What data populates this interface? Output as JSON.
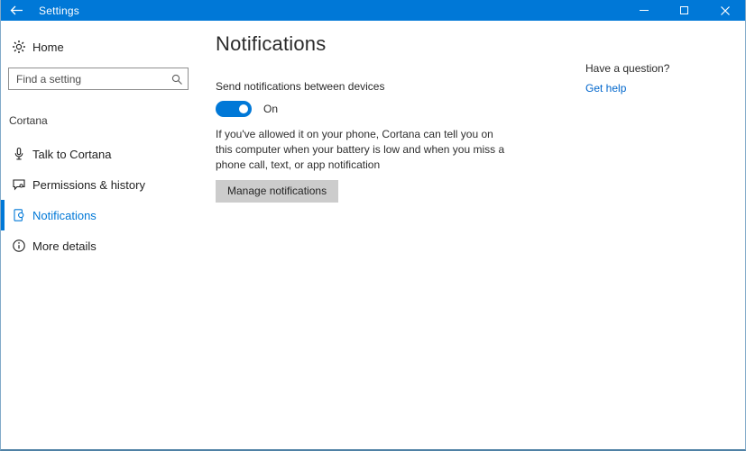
{
  "window": {
    "title": "Settings"
  },
  "sidebar": {
    "home_label": "Home",
    "search_placeholder": "Find a setting",
    "section_label": "Cortana",
    "items": [
      {
        "label": "Talk to Cortana",
        "icon": "microphone-icon"
      },
      {
        "label": "Permissions & history",
        "icon": "permissions-icon"
      },
      {
        "label": "Notifications",
        "icon": "notifications-icon"
      },
      {
        "label": "More details",
        "icon": "info-icon"
      }
    ]
  },
  "main": {
    "title": "Notifications",
    "setting_label": "Send notifications between devices",
    "toggle_state_label": "On",
    "description": "If you've allowed it on your phone, Cortana can tell you on this computer when your battery is low and when you miss a phone call, text, or app notification",
    "manage_button_label": "Manage notifications"
  },
  "help": {
    "question": "Have a question?",
    "link_label": "Get help"
  },
  "colors": {
    "accent": "#0078d7",
    "titlebar_background": "#0078d7",
    "selected_item_text": "#0078d7",
    "toggle_on": "#0078d7",
    "link": "#0066cc",
    "button_background": "#cccccc",
    "window_border": "#4f81a5"
  }
}
